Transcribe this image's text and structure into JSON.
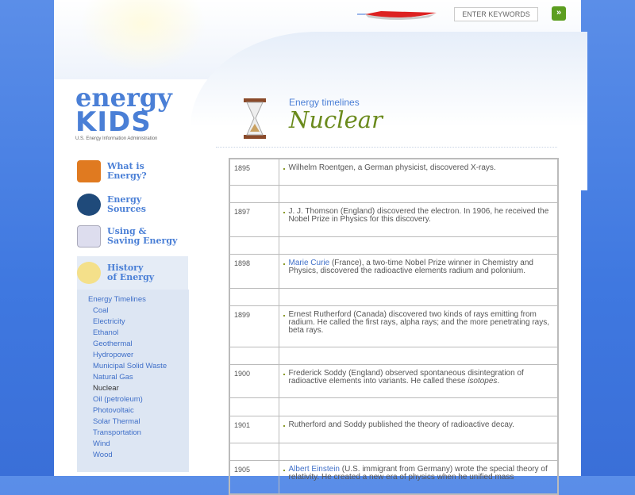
{
  "header": {
    "search_placeholder": "ENTER KEYWORDS",
    "go_label": "»"
  },
  "logo": {
    "line1": "energy",
    "line2": "KIDS",
    "subtitle": "U.S. Energy Information Administration"
  },
  "nav": [
    {
      "l1": "What is",
      "l2": "Energy?"
    },
    {
      "l1": "Energy",
      "l2": "Sources"
    },
    {
      "l1": "Using &",
      "l2": "Saving Energy"
    },
    {
      "l1": "History",
      "l2": "of Energy"
    }
  ],
  "timelines": {
    "heading": "Energy Timelines",
    "items": [
      "Coal",
      "Electricity",
      "Ethanol",
      "Geothermal",
      "Hydropower",
      "Municipal Solid Waste",
      "Natural Gas",
      "Nuclear",
      "Oil (petroleum)",
      "Photovoltaic",
      "Solar Thermal",
      "Transportation",
      "Wind",
      "Wood"
    ]
  },
  "page": {
    "subtitle": "Energy timelines",
    "title": "Nuclear"
  },
  "rows": [
    {
      "year": "1895",
      "text": "Wilhelm Roentgen, a German physicist, discovered X-rays."
    },
    {
      "year": "1897",
      "text": "J. J. Thomson (England) discovered the electron. In 1906, he received the Nobel Prize in Physics for this discovery."
    },
    {
      "year": "1898",
      "link": "Marie Curie",
      "text": " (France), a two-time Nobel Prize winner in Chemistry and Physics, discovered the radioactive elements radium and polonium."
    },
    {
      "year": "1899",
      "text": "Ernest Rutherford (Canada) discovered two kinds of rays emitting from radium. He called the first rays, alpha rays; and the more penetrating rays, beta rays."
    },
    {
      "year": "1900",
      "text": "Frederick Soddy (England) observed spontaneous disintegration of radioactive elements into variants.  He called these ",
      "em": "isotopes",
      "tail": "."
    },
    {
      "year": "1901",
      "text": "Rutherford and Soddy published the theory of radioactive decay."
    },
    {
      "year": "1905",
      "link": "Albert Einstein",
      "text": " (U.S. immigrant from Germany) wrote the special theory of relativity.  He created a new era of physics when he unified mass"
    }
  ]
}
